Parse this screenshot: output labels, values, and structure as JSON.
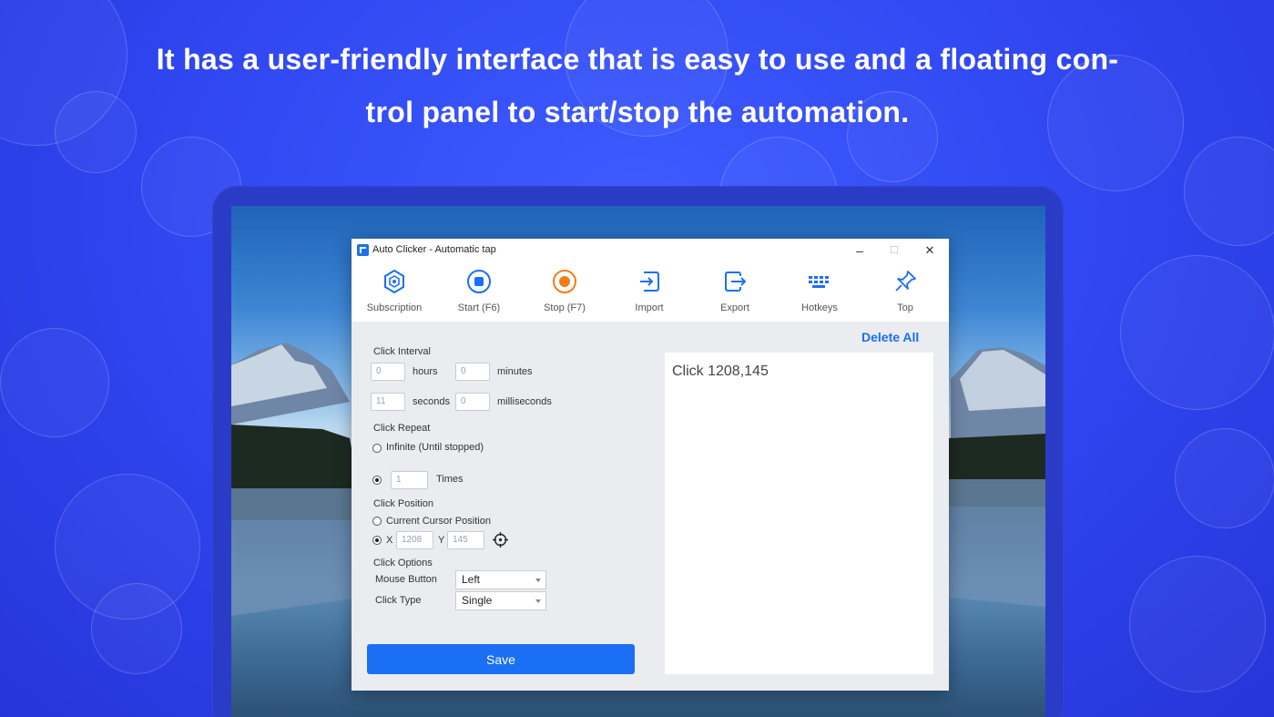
{
  "headline": {
    "line1": "It has a user-friendly interface that is easy to use and a floating con-",
    "line2": "trol panel to start/stop the automation."
  },
  "window": {
    "title": "Auto Clicker - Automatic tap",
    "minimize": "–",
    "maximize": "☐",
    "close": "✕"
  },
  "toolbar": {
    "subscription": "Subscription",
    "start": "Start (F6)",
    "stop": "Stop (F7)",
    "import": "Import",
    "export": "Export",
    "hotkeys": "Hotkeys",
    "top": "Top"
  },
  "colors": {
    "accent": "#1a6ff5",
    "stop": "#f07d1a",
    "background": "#2f45f0"
  },
  "interval": {
    "label": "Click Interval",
    "hours_value": "0",
    "hours_label": "hours",
    "minutes_value": "0",
    "minutes_label": "minutes",
    "seconds_value": "11",
    "seconds_label": "seconds",
    "ms_value": "0",
    "ms_label": "milliseconds"
  },
  "repeat": {
    "label": "Click Repeat",
    "infinite_label": "Infinite (Until stopped)",
    "times_value": "1",
    "times_label": "Times",
    "selected": "times"
  },
  "position": {
    "label": "Click Position",
    "current_label": "Current Cursor Position",
    "x_label": "X",
    "x_value": "1208",
    "y_label": "Y",
    "y_value": "145",
    "selected": "xy"
  },
  "options": {
    "label": "Click Options",
    "mouse_button_label": "Mouse Button",
    "mouse_button_value": "Left",
    "click_type_label": "Click Type",
    "click_type_value": "Single"
  },
  "save_label": "Save",
  "list": {
    "delete_all": "Delete All",
    "items": [
      "Click 1208,145"
    ]
  }
}
